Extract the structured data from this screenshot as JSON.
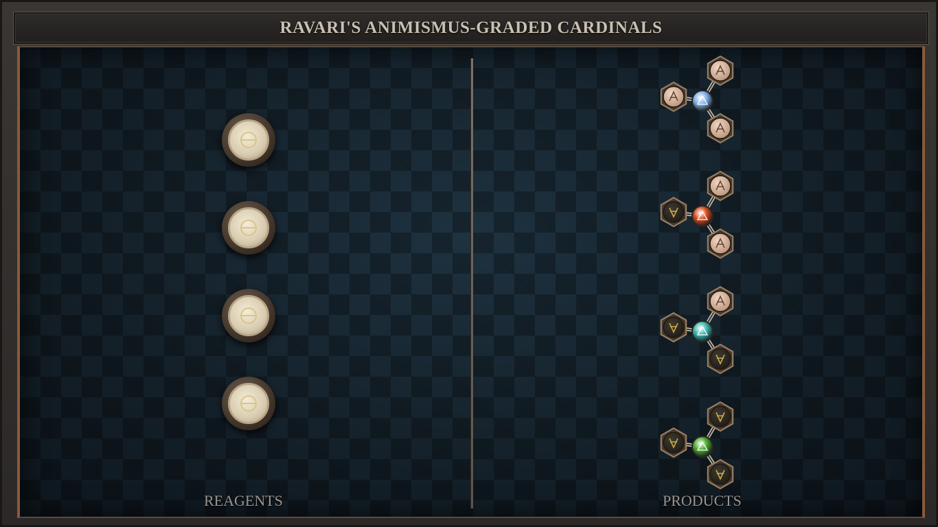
{
  "window": {
    "title": "RAVARI'S ANIMISMUS-GRADED CARDINALS"
  },
  "reagents": {
    "label": "REAGENTS",
    "items": [
      {
        "icon": "salt-glyph-icon"
      },
      {
        "icon": "salt-glyph-icon"
      },
      {
        "icon": "salt-glyph-icon"
      },
      {
        "icon": "salt-glyph-icon"
      }
    ]
  },
  "products": {
    "label": "PRODUCTS",
    "items": [
      {
        "icon": "air-molecule-icon",
        "core_color": "#7fb0e8",
        "nodes": [
          "up",
          "up",
          "up"
        ]
      },
      {
        "icon": "fire-molecule-icon",
        "core_color": "#d64a1e",
        "nodes": [
          "up",
          "down",
          "up"
        ]
      },
      {
        "icon": "water-molecule-icon",
        "core_color": "#3fb7b0",
        "nodes": [
          "up",
          "down",
          "down"
        ]
      },
      {
        "icon": "earth-molecule-icon",
        "core_color": "#4caa2c",
        "nodes": [
          "down",
          "down",
          "down"
        ]
      }
    ]
  },
  "colors": {
    "title_text": "#c9c0b2",
    "panel_background": "#132029",
    "panel_border": "#8a5a3a",
    "label_text": "#9a9590"
  }
}
